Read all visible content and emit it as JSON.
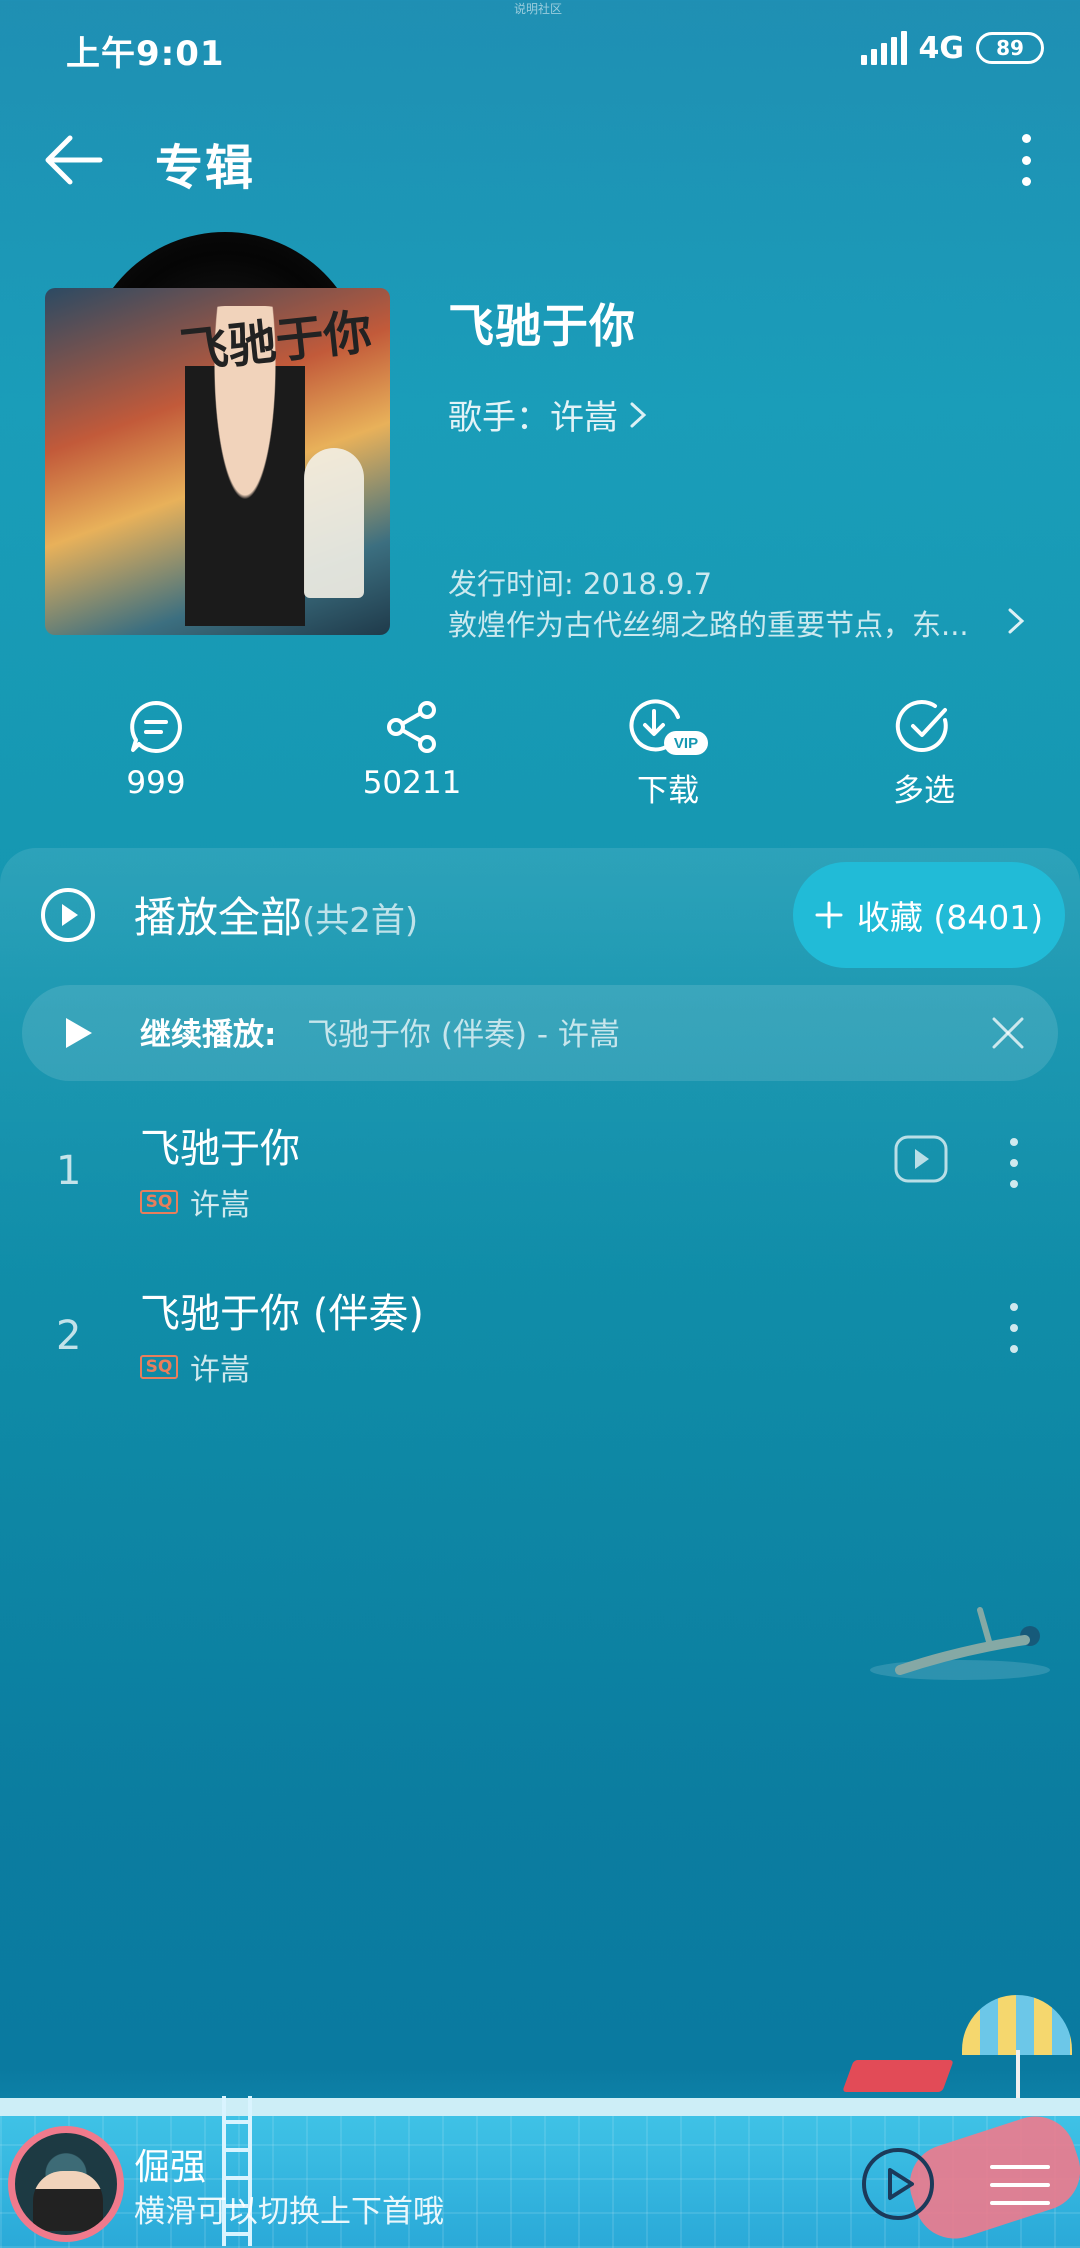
{
  "status_bar": {
    "time": "上午9:01",
    "network": "4G",
    "battery": "89",
    "top_hint": "说明社区"
  },
  "header": {
    "title": "专辑",
    "back_icon": "back-arrow-icon",
    "more_icon": "more-vertical-icon"
  },
  "album": {
    "name": "飞驰于你",
    "artist_label": "歌手：许嵩",
    "release": "发行时间: 2018.9.7",
    "description": "敦煌作为古代丝绸之路的重要节点，东...",
    "cover_text": "飞驰于你"
  },
  "actions": [
    {
      "icon": "comment-icon",
      "label": "999"
    },
    {
      "icon": "share-icon",
      "label": "50211"
    },
    {
      "icon": "download-vip-icon",
      "label": "下载",
      "badge": "VIP"
    },
    {
      "icon": "multi-select-icon",
      "label": "多选"
    }
  ],
  "play_all": {
    "label": "播放全部",
    "count": "(共2首)"
  },
  "collect": {
    "label": "收藏 (8401)"
  },
  "resume": {
    "label": "继续播放:",
    "track": "飞驰于你 (伴奏) - 许嵩"
  },
  "songs": [
    {
      "index": "1",
      "title": "飞驰于你",
      "quality": "SQ",
      "artist": "许嵩",
      "has_mv": true
    },
    {
      "index": "2",
      "title": "飞驰于你 (伴奏)",
      "quality": "SQ",
      "artist": "许嵩",
      "has_mv": false
    }
  ],
  "mini_player": {
    "title": "倔强",
    "subtitle": "横滑可以切换上下首哦"
  },
  "colors": {
    "accent": "#21bbd7",
    "sq_badge": "#e87e5c",
    "background_top": "#1f8fb3",
    "background_bottom": "#0a7aa0"
  }
}
